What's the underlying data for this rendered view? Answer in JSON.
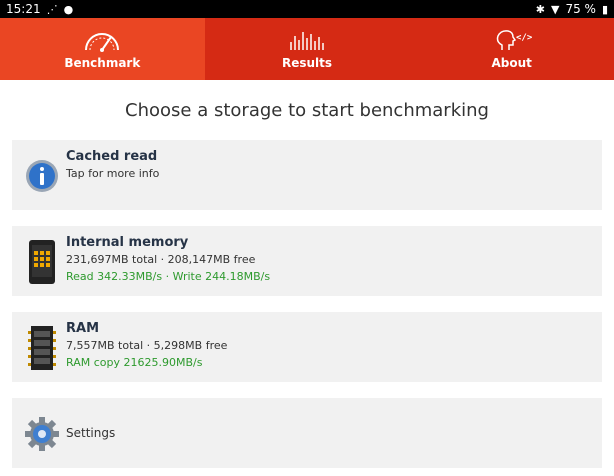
{
  "status_bar": {
    "time": "15:21",
    "battery": "75 %",
    "left_icons": [
      "network-icon",
      "dot-icon"
    ],
    "right_icons": [
      "bluetooth-icon",
      "wifi-icon",
      "battery-icon"
    ]
  },
  "tabs": [
    {
      "label": "Benchmark",
      "icon": "speedometer-icon",
      "active": true
    },
    {
      "label": "Results",
      "icon": "bars-chart-icon",
      "active": false
    },
    {
      "label": "About",
      "icon": "head-code-icon",
      "active": false
    }
  ],
  "prompt": "Choose a storage to start benchmarking",
  "cards": {
    "cached": {
      "title": "Cached read",
      "subtitle": "Tap for more info",
      "icon": "info-icon"
    },
    "internal": {
      "title": "Internal memory",
      "detail": "231,697MB total · 208,147MB free",
      "speed": "Read 342.33MB/s · Write 244.18MB/s",
      "icon": "phone-icon"
    },
    "ram": {
      "title": "RAM",
      "detail": "7,557MB total · 5,298MB free",
      "speed": "RAM copy 21625.90MB/s",
      "icon": "memory-chip-icon"
    },
    "settings": {
      "label": "Settings",
      "icon": "gear-icon"
    }
  },
  "colors": {
    "tab_bar": "#d52a14",
    "tab_active": "#ea4623",
    "speed_text": "#2e9a2e",
    "card_bg": "#f1f1f1"
  }
}
